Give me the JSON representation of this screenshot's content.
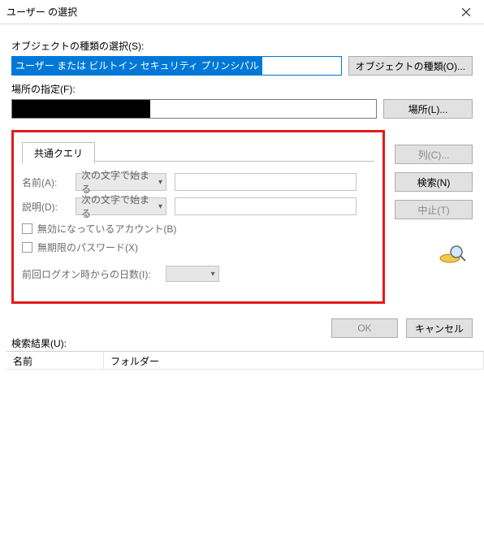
{
  "titlebar": {
    "title": "ユーザー の選択"
  },
  "sections": {
    "object_type_label": "オブジェクトの種類の選択(S):",
    "object_type_value": "ユーザー または ビルトイン セキュリティ プリンシパル",
    "object_type_button": "オブジェクトの種類(O)...",
    "location_label": "場所の指定(F):",
    "location_button": "場所(L)..."
  },
  "query": {
    "tab": "共通クエリ",
    "name_label": "名前(A):",
    "desc_label": "説明(D):",
    "combo_begins_with": "次の文字で始まる",
    "chk_disabled": "無効になっているアカウント(B)",
    "chk_noexpire": "無期限のパスワード(X)",
    "days_label": "前回ログオン時からの日数(I):"
  },
  "right_buttons": {
    "columns": "列(C)...",
    "search": "検索(N)",
    "stop": "中止(T)"
  },
  "bottom_buttons": {
    "ok": "OK",
    "cancel": "キャンセル"
  },
  "results": {
    "label": "検索結果(U):",
    "col_name": "名前",
    "col_folder": "フォルダー"
  }
}
